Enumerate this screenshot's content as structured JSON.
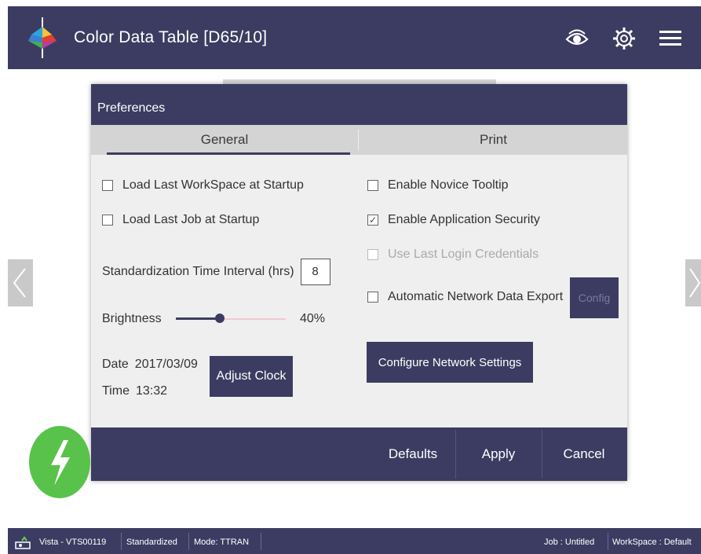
{
  "header": {
    "title": "Color Data Table [D65/10]",
    "icons": [
      "app-logo-icon",
      "eye-icon",
      "gear-icon",
      "hamburger-menu-icon"
    ]
  },
  "dialog": {
    "title": "Preferences",
    "tabs": {
      "general": "General",
      "print": "Print",
      "active": "General"
    },
    "left": {
      "load_workspace": {
        "label": "Load Last WorkSpace at Startup",
        "checked": false
      },
      "load_job": {
        "label": "Load Last Job at Startup",
        "checked": false
      },
      "std_interval_label": "Standardization Time Interval (hrs)",
      "std_interval_value": "8",
      "brightness_label": "Brightness",
      "brightness_value": "40%",
      "brightness_fraction": 0.4,
      "date_label": "Date",
      "date_value": "2017/03/09",
      "time_label": "Time",
      "time_value": "13:32",
      "adjust_clock": "Adjust Clock"
    },
    "right": {
      "novice_tooltip": {
        "label": "Enable Novice Tooltip",
        "checked": false
      },
      "app_security": {
        "label": "Enable Application Security",
        "checked": true
      },
      "last_login": {
        "label": "Use Last Login Credentials",
        "checked": false,
        "disabled": true
      },
      "auto_export": {
        "label": "Automatic Network Data Export",
        "checked": false
      },
      "config": "Config",
      "configure_network": "Configure Network Settings"
    },
    "footer": {
      "defaults": "Defaults",
      "apply": "Apply",
      "cancel": "Cancel"
    }
  },
  "status_bar": {
    "instrument": "Vista - VTS00119",
    "state": "Standardized",
    "mode": "Mode: TTRAN",
    "job": "Job : Untitled",
    "workspace": "WorkSpace : Default"
  },
  "colors": {
    "primary": "#3c3c62",
    "dialog_body": "#efefef",
    "tab_bar": "#d4d4d4",
    "bolt_green": "#58c24a"
  }
}
